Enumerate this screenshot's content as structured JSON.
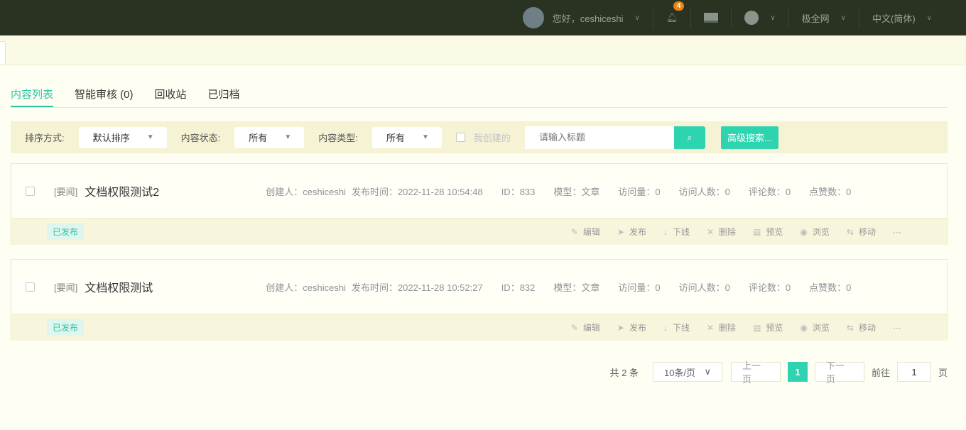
{
  "header": {
    "greeting": "您好，ceshiceshi",
    "notification_count": "4",
    "site": "极全网",
    "language": "中文(简体)"
  },
  "tabs": [
    "内容列表",
    "智能审核 (0)",
    "回收站",
    "已归档"
  ],
  "filter": {
    "sort_label": "排序方式:",
    "sort_value": "默认排序",
    "status_label": "内容状态:",
    "status_value": "所有",
    "type_label": "内容类型:",
    "type_value": "所有",
    "mine_label": "我创建的",
    "search_placeholder": "请输入标题",
    "advanced": "高级搜索..."
  },
  "items": [
    {
      "tag": "[要闻]",
      "title": "文档权限测试2",
      "creator": "创建人：ceshiceshi",
      "time": "发布时间：2022-11-28 10:54:48",
      "id": "ID：833",
      "model": "模型：文章",
      "visits": "访问量：0",
      "visitors": "访问人数：0",
      "comments": "评论数：0",
      "likes": "点赞数：0",
      "status": "已发布"
    },
    {
      "tag": "[要闻]",
      "title": "文档权限测试",
      "creator": "创建人：ceshiceshi",
      "time": "发布时间：2022-11-28 10:52:27",
      "id": "ID：832",
      "model": "模型：文章",
      "visits": "访问量：0",
      "visitors": "访问人数：0",
      "comments": "评论数：0",
      "likes": "点赞数：0",
      "status": "已发布"
    }
  ],
  "actions": [
    "编辑",
    "发布",
    "下线",
    "删除",
    "预览",
    "浏览",
    "移动",
    "···"
  ],
  "pagination": {
    "total": "共 2 条",
    "page_size": "10条/页",
    "prev": "上一页",
    "current": "1",
    "next": "下一页",
    "goto_label": "前往",
    "goto_value": "1",
    "page_suffix": "页"
  }
}
